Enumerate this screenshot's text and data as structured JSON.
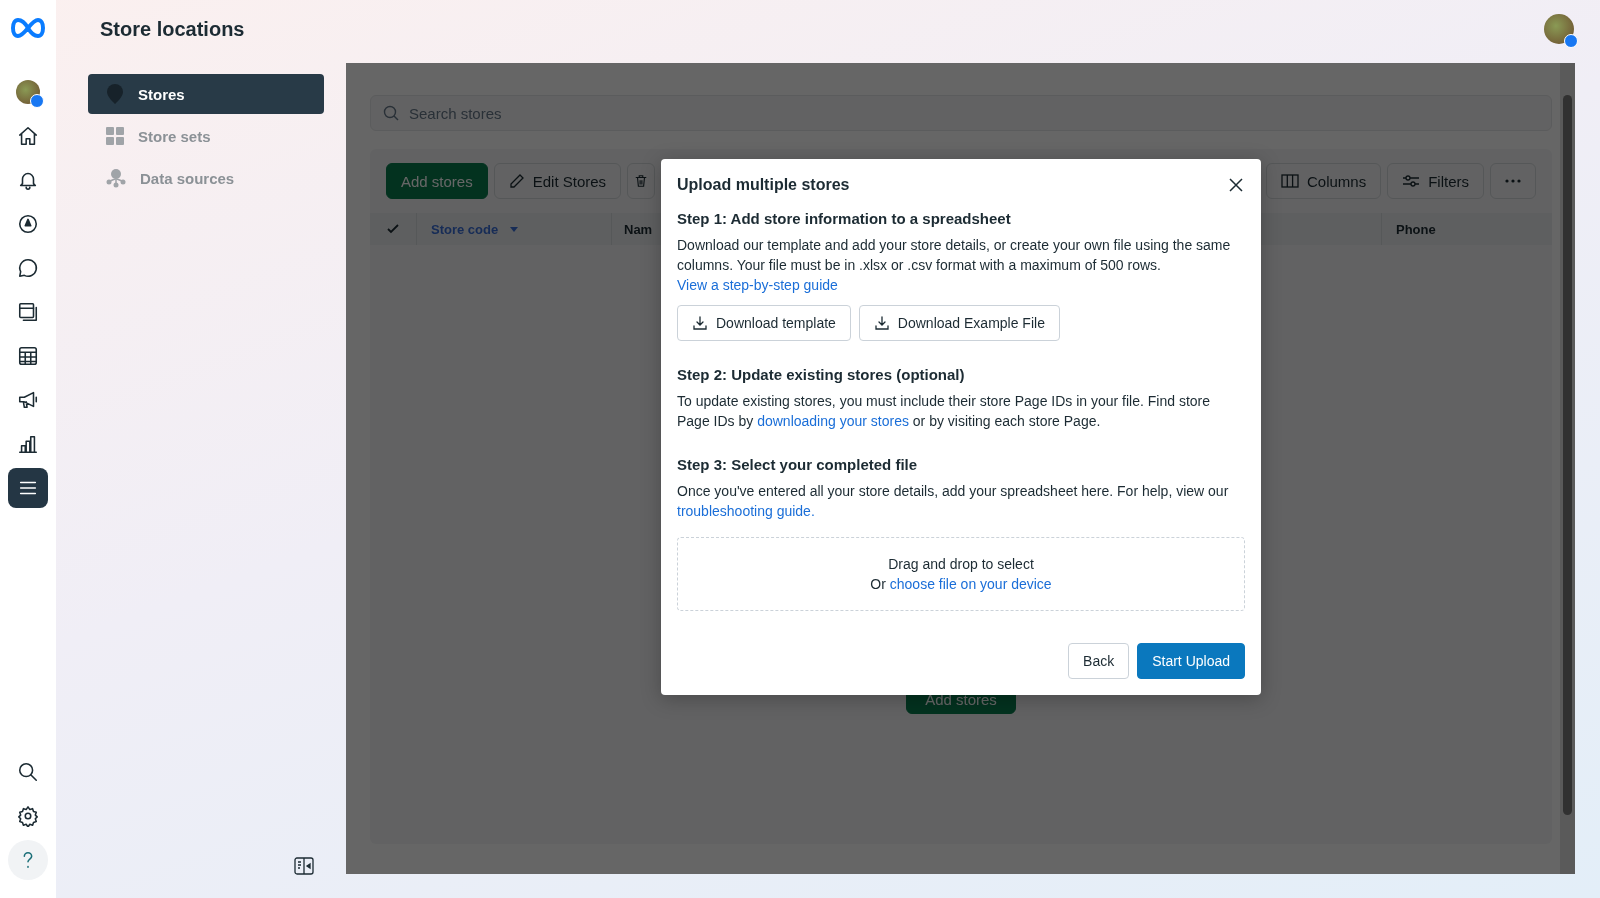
{
  "app": {
    "title": "Store locations"
  },
  "rail": {
    "top": [
      {
        "kind": "avatar",
        "selected": false
      },
      {
        "kind": "home",
        "selected": false
      },
      {
        "kind": "bell",
        "selected": false
      },
      {
        "kind": "compass",
        "selected": false
      },
      {
        "kind": "chat",
        "selected": false
      },
      {
        "kind": "pages",
        "selected": false
      },
      {
        "kind": "table",
        "selected": false
      },
      {
        "kind": "megaphone",
        "selected": false
      },
      {
        "kind": "chart",
        "selected": false
      },
      {
        "kind": "menu",
        "selected": true
      }
    ],
    "bottom": [
      {
        "kind": "search"
      },
      {
        "kind": "settings"
      },
      {
        "kind": "help"
      }
    ]
  },
  "sidebar": {
    "items": [
      {
        "label": "Stores",
        "kind": "pin",
        "selected": true
      },
      {
        "label": "Store sets",
        "kind": "grid",
        "selected": false
      },
      {
        "label": "Data sources",
        "kind": "nodes",
        "selected": false
      }
    ]
  },
  "main": {
    "search": {
      "placeholder": "Search stores"
    },
    "toolbar": {
      "left": [
        {
          "kind": "primary",
          "label": "Add stores"
        },
        {
          "kind": "edit",
          "label": "Edit Stores"
        },
        {
          "kind": "delete"
        }
      ],
      "right": [
        {
          "kind": "columns",
          "label": "Columns"
        },
        {
          "kind": "filters",
          "label": "Filters"
        },
        {
          "kind": "more"
        }
      ]
    },
    "table": {
      "select_all": {
        "checked": true
      },
      "columns": [
        {
          "label": "Store code",
          "sorted": true
        },
        {
          "label": "Nam",
          "sorted": false
        },
        {
          "label": "Phone",
          "sorted": false
        }
      ]
    },
    "empty_state": {
      "button": "Add stores"
    }
  },
  "modal": {
    "title": "Upload multiple stores",
    "steps": [
      {
        "heading": "Step 1: Add store information to a spreadsheet",
        "body": [
          {
            "text": "Download our template and add your store details, or create your own file using the same columns. Your file must be in .xlsx or .csv format with a maximum of 500 rows."
          }
        ],
        "link": "View a step-by-step guide",
        "buttons": [
          "Download template",
          "Download Example File"
        ]
      },
      {
        "heading": "Step 2: Update existing stores (optional)",
        "body": [
          {
            "text": "To update existing stores, you must include their store Page IDs in your file. Find store Page IDs by "
          },
          {
            "link": "downloading your stores"
          },
          {
            "text": " or by visiting each store Page."
          }
        ]
      },
      {
        "heading": "Step 3: Select your completed file",
        "body": [
          {
            "text": "Once you've entered all your store details, add your spreadsheet here. For help, view our "
          },
          {
            "link": "troubleshooting guide."
          }
        ]
      }
    ],
    "dropzone": {
      "text": "Drag and drop to select",
      "prefix": "Or",
      "link": "choose file on your device"
    },
    "footer": [
      {
        "kind": "secondary",
        "label": "Back"
      },
      {
        "kind": "primary",
        "label": "Start Upload"
      }
    ]
  }
}
